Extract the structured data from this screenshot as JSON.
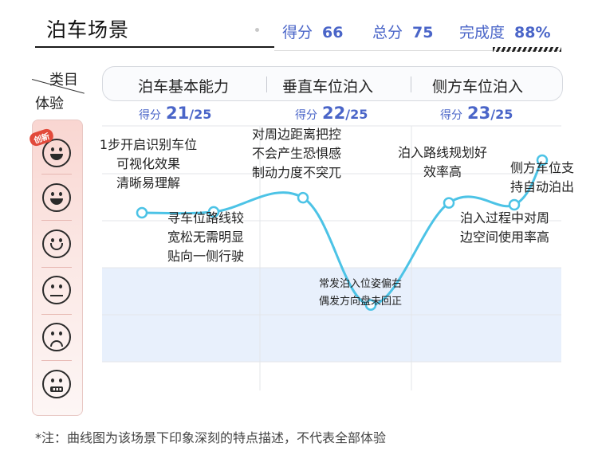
{
  "header": {
    "title": "泊车场景",
    "scores": [
      {
        "label": "得分",
        "value": "66"
      },
      {
        "label": "总分",
        "value": "75"
      },
      {
        "label": "完成度",
        "value": "88%"
      }
    ]
  },
  "corner": {
    "top": "类目",
    "bottom": "体验"
  },
  "categories": [
    {
      "name": "泊车基本能力",
      "score_label": "得分",
      "score": "21",
      "total": "/25"
    },
    {
      "name": "垂直车位泊入",
      "score_label": "得分",
      "score": "22",
      "total": "/25"
    },
    {
      "name": "侧方车位泊入",
      "score_label": "得分",
      "score": "23",
      "total": "/25"
    }
  ],
  "badge": "创新",
  "faces": [
    "star-eyes-face-icon",
    "grin-face-icon",
    "smile-face-icon",
    "neutral-face-icon",
    "frown-face-icon",
    "grimace-face-icon"
  ],
  "chart_data": {
    "type": "line",
    "y_levels": [
      "创新",
      "非常满意",
      "满意",
      "一般",
      "不满意",
      "非常不满意"
    ],
    "points": [
      {
        "level": 4.66,
        "lines": [
          "1步开启识别车位",
          "可视化效果",
          "清晰易理解"
        ]
      },
      {
        "level": 4.68,
        "lines": [
          "寻车位路线较",
          "宽松无需明显",
          "贴向一侧行驶"
        ]
      },
      {
        "level": 4.98,
        "lines": [
          "对周边距离把控",
          "不会产生恐惧感",
          "制动力度不突兀"
        ]
      },
      {
        "level": 2.7,
        "lines": [
          "常发泊入位姿偏右",
          "偶发方向盘未回正"
        ]
      },
      {
        "level": 4.87,
        "lines": [
          "泊入路线规划好",
          "效率高"
        ]
      },
      {
        "level": 4.83,
        "lines": [
          "泊入过程中对周",
          "边空间使用率高"
        ]
      },
      {
        "level": 5.78,
        "lines": [
          "侧方车位支",
          "持自动泊出"
        ]
      }
    ],
    "line_color": "#4cc3e6",
    "band_color": "#e8f0fc"
  },
  "footnote": "*注：曲线图为该场景下印象深刻的特点描述，不代表全部体验"
}
